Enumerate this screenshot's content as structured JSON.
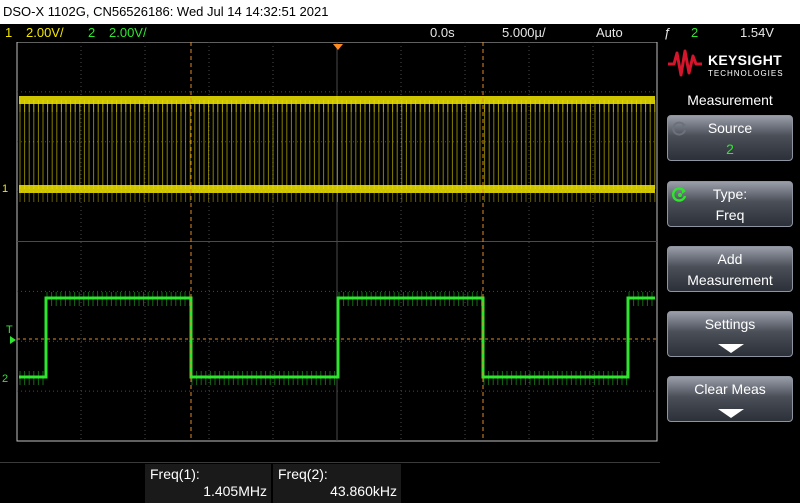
{
  "title_bar": {
    "text": "DSO-X 1102G, CN56526186: Wed Jul 14 14:32:51 2021"
  },
  "status_bar": {
    "ch1_num": "1",
    "ch1_scale": "2.00V/",
    "ch2_num": "2",
    "ch2_scale": "2.00V/",
    "time_offset": "0.0s",
    "time_scale": "5.000µ/",
    "trigger_mode": "Auto",
    "trigger_icon": "ƒ",
    "trigger_source": "2",
    "trigger_level": "1.54V"
  },
  "plot": {
    "ch1_marker": "1",
    "ch2_marker": "2",
    "trigger_marker": "T",
    "ch1_color": "#f2e600",
    "ch2_color": "#2ee62e",
    "cursor_color": "#e08a2a",
    "grid_color": "#4a4a4a"
  },
  "logo": {
    "brand": "KEYSIGHT",
    "sub": "TECHNOLOGIES",
    "brand_color": "#d4152b"
  },
  "panel": {
    "title": "Measurement",
    "buttons": [
      {
        "line1": "Source",
        "line2": "2"
      },
      {
        "line1": "Type:",
        "line2": "Freq"
      },
      {
        "line1": "Add",
        "line2": "Measurement"
      },
      {
        "line1": "Settings"
      },
      {
        "line1": "Clear Meas"
      }
    ]
  },
  "measurements": [
    {
      "label": "Freq(1):",
      "value": "1.405MHz"
    },
    {
      "label": "Freq(2):",
      "value": "43.860kHz"
    }
  ]
}
